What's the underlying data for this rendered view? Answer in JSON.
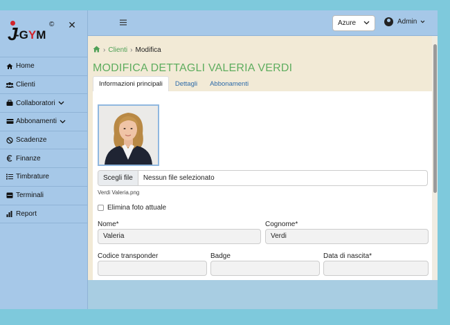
{
  "brand": {
    "logo_text": "J-GYM",
    "logo_letter_j": "J",
    "logo_rest": "-G",
    "logo_y": "Y",
    "logo_m": "M",
    "copyright": "©"
  },
  "sidebar": {
    "close_glyph": "✕",
    "items": [
      {
        "label": "Home",
        "icon": "home-icon"
      },
      {
        "label": "Clienti",
        "icon": "users-icon"
      },
      {
        "label": "Collaboratori",
        "icon": "briefcase-icon",
        "has_submenu": true
      },
      {
        "label": "Abbonamenti",
        "icon": "card-icon",
        "has_submenu": true
      },
      {
        "label": "Scadenze",
        "icon": "ban-icon"
      },
      {
        "label": "Finanze",
        "icon": "euro-icon"
      },
      {
        "label": "Timbrature",
        "icon": "list-icon"
      },
      {
        "label": "Terminali",
        "icon": "terminal-icon"
      },
      {
        "label": "Report",
        "icon": "chart-icon"
      }
    ]
  },
  "topbar": {
    "menu_glyph": "≡",
    "theme": "Azure",
    "user": "Admin"
  },
  "breadcrumb": {
    "parent": "Clienti",
    "current": "Modifica"
  },
  "page": {
    "title": "MODIFICA DETTAGLI VALERIA VERDI",
    "tabs": [
      "Informazioni principali",
      "Dettagli",
      "Abbonamenti"
    ],
    "active_tab": 0
  },
  "form": {
    "file_button": "Scegli file",
    "file_status": "Nessun file selezionato",
    "file_name": "Verdi Valeria.png",
    "delete_photo_label": "Elimina foto attuale",
    "nome_label": "Nome*",
    "nome_value": "Valeria",
    "cognome_label": "Cognome*",
    "cognome_value": "Verdi",
    "transponder_label": "Codice transponder",
    "transponder_value": "",
    "badge_label": "Badge",
    "badge_value": "",
    "nascita_label": "Data di nascita*",
    "nascita_value": ""
  },
  "colors": {
    "sidebar": "#a6c8e8",
    "content_bg": "#f2ead6",
    "title_green": "#5fad5f",
    "link_blue": "#2c6aa8",
    "brand_red": "#d2232a"
  }
}
